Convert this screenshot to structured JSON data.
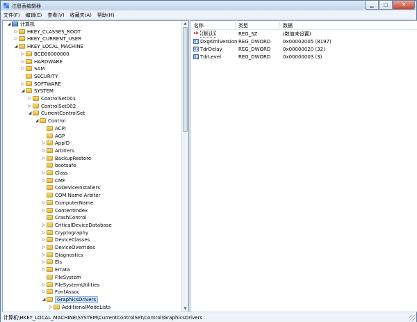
{
  "window": {
    "title": "注册表编辑器"
  },
  "menu": [
    "文件(F)",
    "编辑(E)",
    "查看(V)",
    "收藏夹(A)",
    "帮助(H)"
  ],
  "tree": [
    {
      "label": "计算机",
      "level": 0,
      "arrow": "expanded",
      "icon": "computer"
    },
    {
      "label": "HKEY_CLASSES_ROOT",
      "level": 1,
      "arrow": "collapsed",
      "icon": "folder"
    },
    {
      "label": "HKEY_CURRENT_USER",
      "level": 1,
      "arrow": "collapsed",
      "icon": "folder"
    },
    {
      "label": "HKEY_LOCAL_MACHINE",
      "level": 1,
      "arrow": "expanded",
      "icon": "folder"
    },
    {
      "label": "BCD00000000",
      "level": 2,
      "arrow": "collapsed",
      "icon": "folder"
    },
    {
      "label": "HARDWARE",
      "level": 2,
      "arrow": "collapsed",
      "icon": "folder"
    },
    {
      "label": "SAM",
      "level": 2,
      "arrow": "collapsed",
      "icon": "folder"
    },
    {
      "label": "SECURITY",
      "level": 2,
      "arrow": "none",
      "icon": "folder"
    },
    {
      "label": "SOFTWARE",
      "level": 2,
      "arrow": "collapsed",
      "icon": "folder"
    },
    {
      "label": "SYSTEM",
      "level": 2,
      "arrow": "expanded",
      "icon": "folder"
    },
    {
      "label": "ControlSet001",
      "level": 3,
      "arrow": "collapsed",
      "icon": "folder"
    },
    {
      "label": "ControlSet002",
      "level": 3,
      "arrow": "collapsed",
      "icon": "folder"
    },
    {
      "label": "CurrentControlSet",
      "level": 3,
      "arrow": "expanded",
      "icon": "folder"
    },
    {
      "label": "Control",
      "level": 4,
      "arrow": "expanded",
      "icon": "folder"
    },
    {
      "label": "ACPI",
      "level": 5,
      "arrow": "none",
      "icon": "folder"
    },
    {
      "label": "AGP",
      "level": 5,
      "arrow": "none",
      "icon": "folder"
    },
    {
      "label": "AppID",
      "level": 5,
      "arrow": "collapsed",
      "icon": "folder"
    },
    {
      "label": "Arbiters",
      "level": 5,
      "arrow": "collapsed",
      "icon": "folder"
    },
    {
      "label": "BackupRestore",
      "level": 5,
      "arrow": "collapsed",
      "icon": "folder"
    },
    {
      "label": "bootsafe",
      "level": 5,
      "arrow": "none",
      "icon": "folder"
    },
    {
      "label": "Class",
      "level": 5,
      "arrow": "collapsed",
      "icon": "folder"
    },
    {
      "label": "CMF",
      "level": 5,
      "arrow": "collapsed",
      "icon": "folder"
    },
    {
      "label": "CoDeviceInstallers",
      "level": 5,
      "arrow": "none",
      "icon": "folder"
    },
    {
      "label": "COM Name Arbiter",
      "level": 5,
      "arrow": "none",
      "icon": "folder"
    },
    {
      "label": "ComputerName",
      "level": 5,
      "arrow": "collapsed",
      "icon": "folder"
    },
    {
      "label": "ContentIndex",
      "level": 5,
      "arrow": "collapsed",
      "icon": "folder"
    },
    {
      "label": "CrashControl",
      "level": 5,
      "arrow": "none",
      "icon": "folder"
    },
    {
      "label": "CriticalDeviceDatabase",
      "level": 5,
      "arrow": "collapsed",
      "icon": "folder"
    },
    {
      "label": "Cryptography",
      "level": 5,
      "arrow": "collapsed",
      "icon": "folder"
    },
    {
      "label": "DeviceClasses",
      "level": 5,
      "arrow": "collapsed",
      "icon": "folder"
    },
    {
      "label": "DeviceOverrides",
      "level": 5,
      "arrow": "collapsed",
      "icon": "folder"
    },
    {
      "label": "Diagnostics",
      "level": 5,
      "arrow": "collapsed",
      "icon": "folder"
    },
    {
      "label": "Els",
      "level": 5,
      "arrow": "collapsed",
      "icon": "folder"
    },
    {
      "label": "Errata",
      "level": 5,
      "arrow": "collapsed",
      "icon": "folder"
    },
    {
      "label": "FileSystem",
      "level": 5,
      "arrow": "none",
      "icon": "folder"
    },
    {
      "label": "FileSystemUtilities",
      "level": 5,
      "arrow": "collapsed",
      "icon": "folder"
    },
    {
      "label": "FontAssoc",
      "level": 5,
      "arrow": "collapsed",
      "icon": "folder"
    },
    {
      "label": "GraphicsDrivers",
      "level": 5,
      "arrow": "expanded",
      "icon": "folder",
      "selected": true
    },
    {
      "label": "AdditionalModeLists",
      "level": 6,
      "arrow": "collapsed",
      "icon": "folder"
    }
  ],
  "columns": {
    "name": "名称",
    "type": "类型",
    "data": "数据"
  },
  "values": [
    {
      "name": "(默认)",
      "type": "REG_SZ",
      "data": "(数值未设置)",
      "kind": "sz"
    },
    {
      "name": "DxgKrnlVersion",
      "type": "REG_DWORD",
      "data": "0x00002005 (8197)",
      "kind": "dword"
    },
    {
      "name": "TdrDelay",
      "type": "REG_DWORD",
      "data": "0x00000020 (32)",
      "kind": "dword"
    },
    {
      "name": "TdrLevel",
      "type": "REG_DWORD",
      "data": "0x00000003 (3)",
      "kind": "dword"
    }
  ],
  "status": "计算机\\HKEY_LOCAL_MACHINE\\SYSTEM\\CurrentControlSet\\Control\\GraphicsDrivers"
}
